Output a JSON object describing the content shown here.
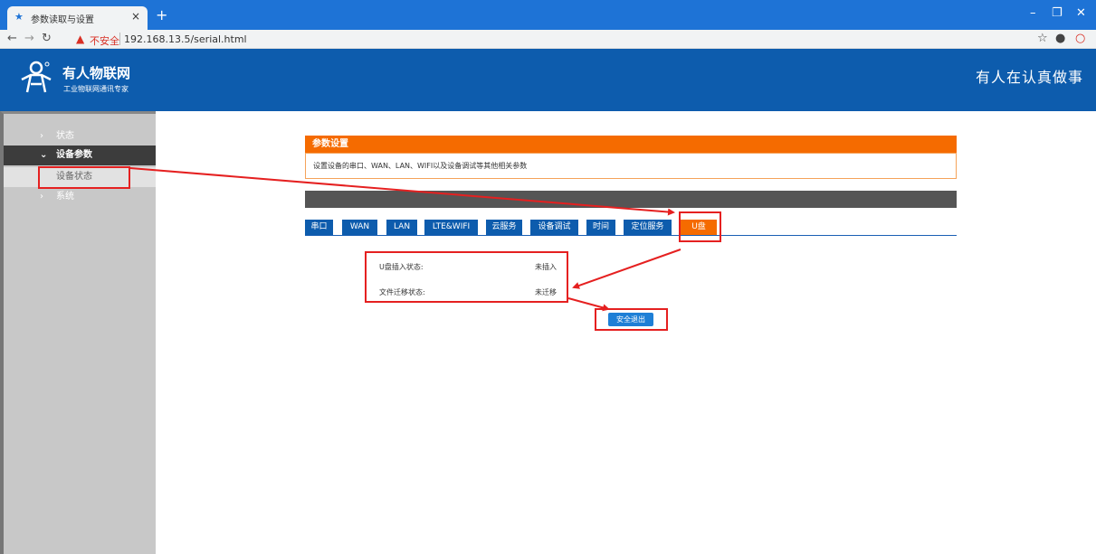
{
  "browser": {
    "tab_title": "参数读取与设置",
    "tab_close": "×",
    "new_tab": "+",
    "insecure_label": "不安全",
    "url": "192.168.13.5/serial.html",
    "minimize": "–",
    "restore": "❐",
    "close": "✕"
  },
  "header": {
    "brand": "有人物联网",
    "brand_sub": "工业物联网通讯专家",
    "slogan": "有人在认真做事"
  },
  "sidebar": {
    "items": [
      {
        "label": "状态"
      },
      {
        "label": "设备参数"
      },
      {
        "label": "设备状态"
      },
      {
        "label": "系统"
      }
    ]
  },
  "panel": {
    "title": "参数设置",
    "description": "设置设备的串口、WAN、LAN、WIFI以及设备调试等其他相关参数"
  },
  "tabs": [
    {
      "label": "串口"
    },
    {
      "label": "WAN"
    },
    {
      "label": "LAN"
    },
    {
      "label": "LTE&WIFI"
    },
    {
      "label": "云服务"
    },
    {
      "label": "设备调试"
    },
    {
      "label": "时间"
    },
    {
      "label": "定位服务"
    },
    {
      "label": "U盘"
    }
  ],
  "usb": {
    "insert_label": "U盘插入状态:",
    "insert_value": "未插入",
    "migrate_label": "文件迁移状态:",
    "migrate_value": "未迁移",
    "eject_button": "安全退出"
  },
  "colors": {
    "browser_blue": "#1e73d6",
    "header_blue": "#0d5cad",
    "accent_orange": "#f56b00",
    "highlight_red": "#e52020"
  }
}
